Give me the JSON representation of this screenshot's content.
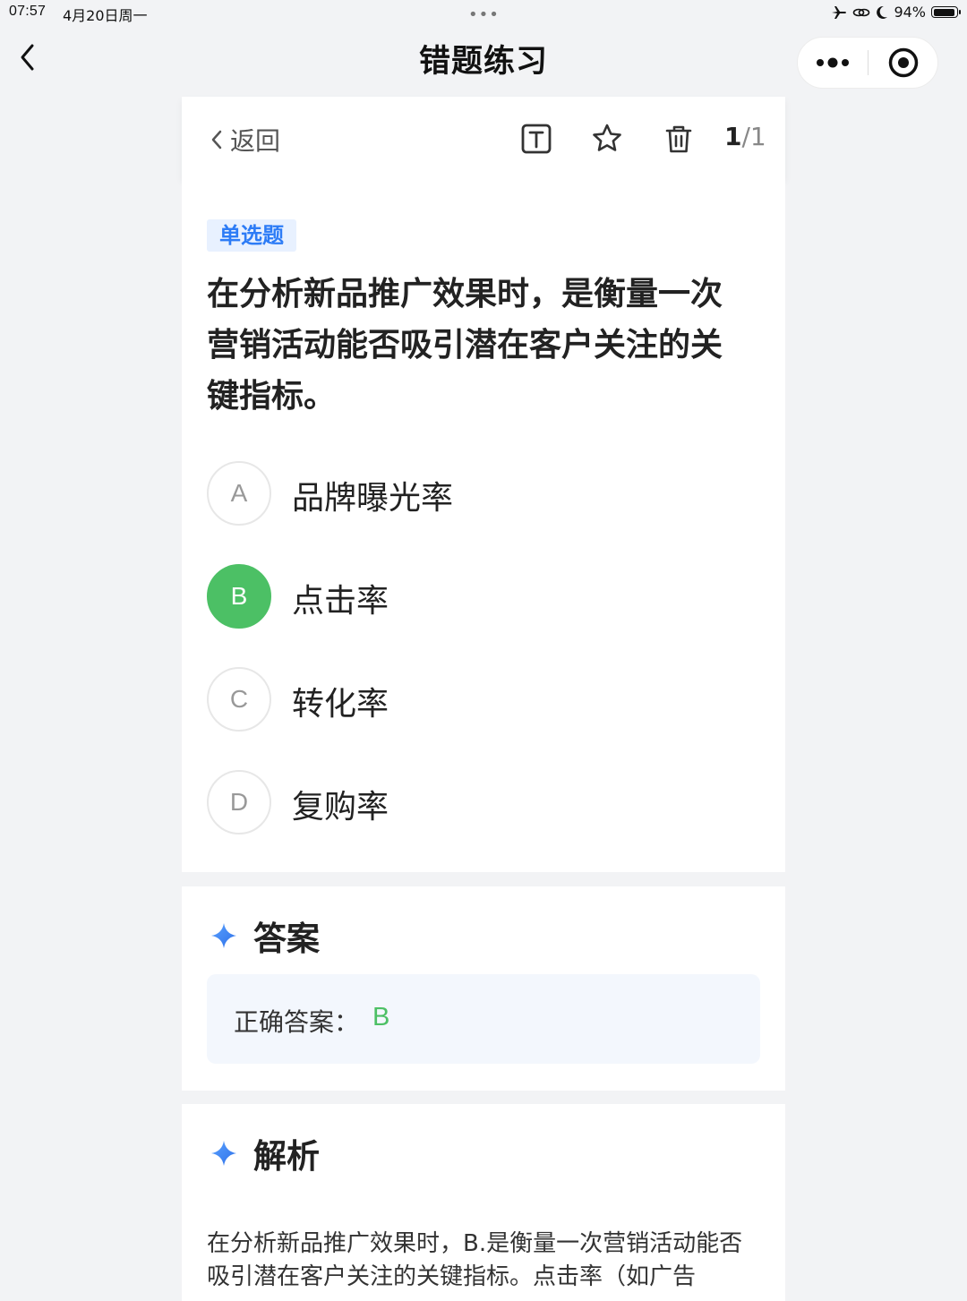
{
  "status_bar": {
    "time": "07:57",
    "date": "4月20日周一",
    "dots": "•••",
    "battery": "94%",
    "battery_level": 0.94
  },
  "nav": {
    "title": "错题练习"
  },
  "toolbar": {
    "back_label": "返回",
    "page_current": "1",
    "page_total": "/1",
    "icons": [
      "text-size-icon",
      "star-icon",
      "trash-icon"
    ]
  },
  "question": {
    "type": "单选题",
    "text": "在分析新品推广效果时，是衡量一次营销活动能否吸引潜在客户关注的关键指标。",
    "options": [
      {
        "letter": "A",
        "text": "品牌曝光率",
        "selected": false
      },
      {
        "letter": "B",
        "text": "点击率",
        "selected": true
      },
      {
        "letter": "C",
        "text": "转化率",
        "selected": false
      },
      {
        "letter": "D",
        "text": "复购率",
        "selected": false
      }
    ]
  },
  "answer": {
    "heading": "答案",
    "label": "正确答案：",
    "value": "B"
  },
  "analysis": {
    "heading": "解析",
    "text": "在分析新品推广效果时，B.是衡量一次营销活动能否吸引潜在客户关注的关键指标。点击率（如广告"
  },
  "colors": {
    "selected": "#4cc065",
    "type_tag_bg": "#e8f1ff",
    "type_tag_text": "#2d7cf6",
    "answer_box_bg": "#f3f7fd",
    "page_bg": "#f2f3f5"
  }
}
